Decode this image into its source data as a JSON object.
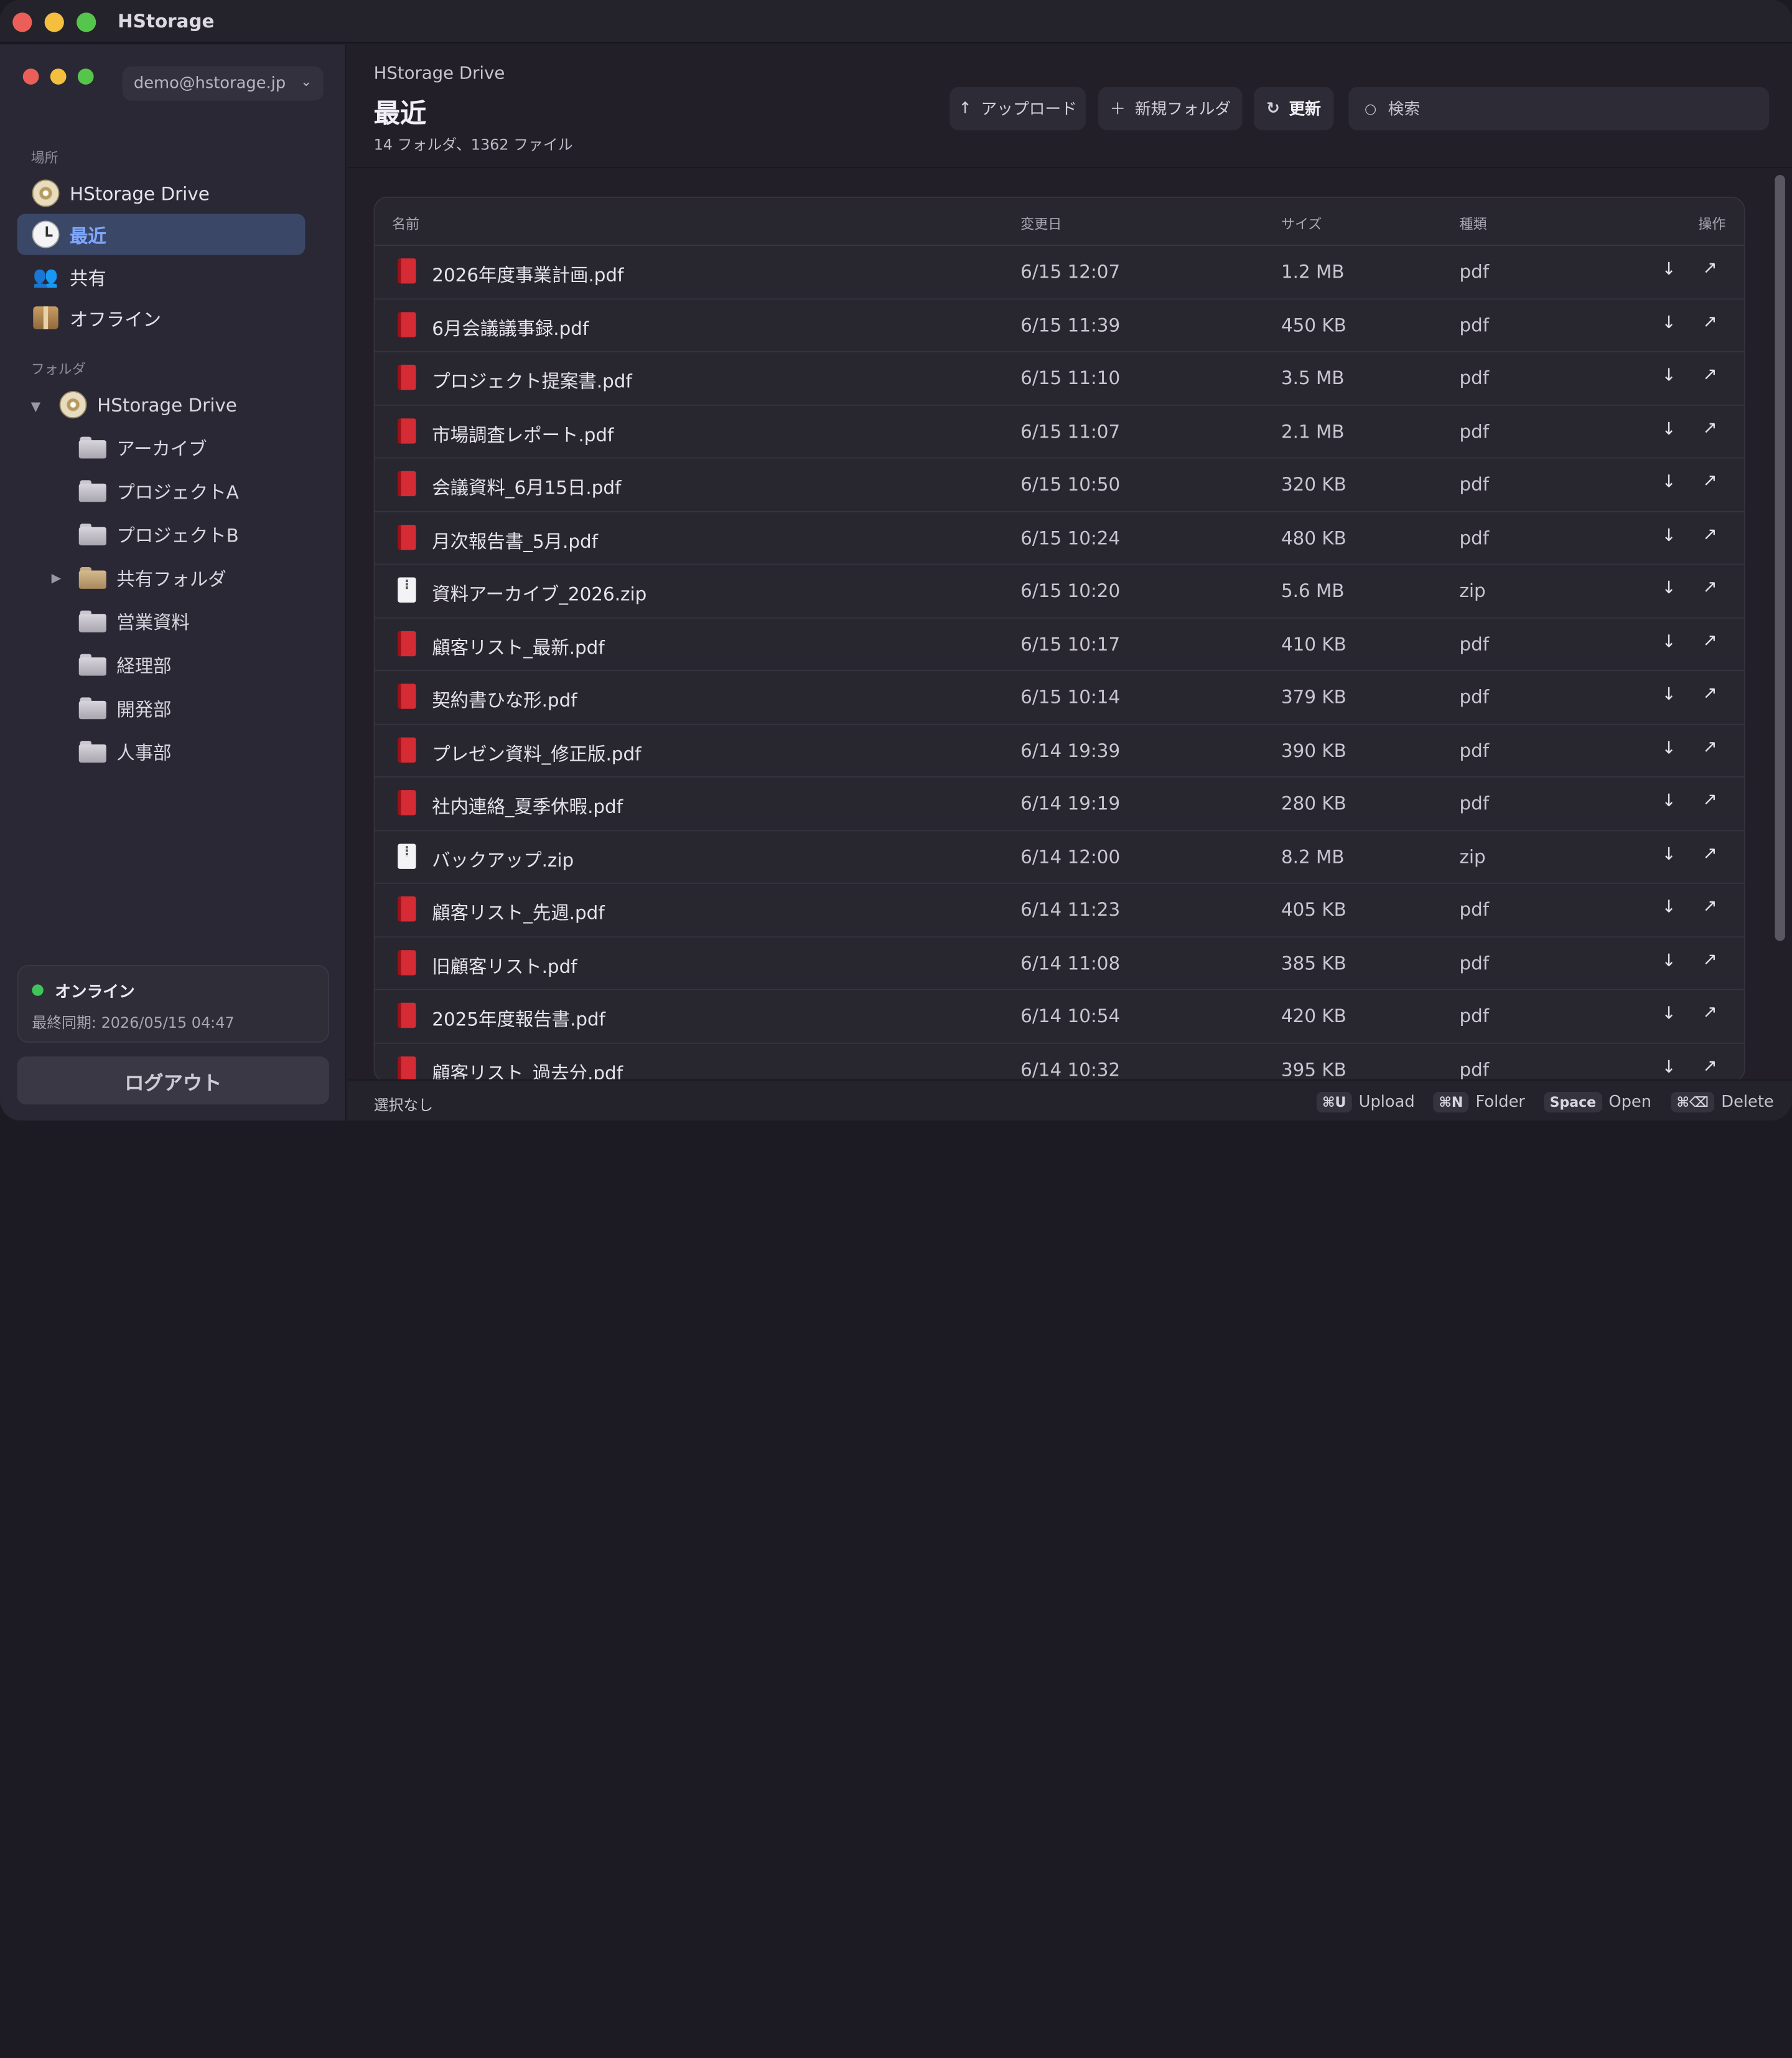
{
  "app": {
    "title": "HStorage"
  },
  "sidebar": {
    "account": "demo@hstorage.jp",
    "places_label": "場所",
    "places": [
      {
        "label": "HStorage Drive",
        "icon": "drive-disc-icon"
      },
      {
        "label": "最近",
        "icon": "clock-icon"
      },
      {
        "label": "共有",
        "icon": "people-icon"
      },
      {
        "label": "オフライン",
        "icon": "package-icon"
      }
    ],
    "folders_label": "フォルダ",
    "root": "HStorage Drive",
    "folders": [
      "アーカイブ",
      "プロジェクトA",
      "プロジェクトB",
      "共有フォルダ",
      "営業資料",
      "経理部",
      "開発部",
      "人事部"
    ],
    "status": "オンライン",
    "last_sync": "最終同期: 2026/05/15 04:47",
    "logout": "ログアウト"
  },
  "main": {
    "breadcrumb": "HStorage Drive",
    "title": "最近",
    "summary": "14 フォルダ、1362 ファイル",
    "toolbar": {
      "upload": "アップロード",
      "new_folder": "新規フォルダ",
      "refresh": "更新",
      "search_placeholder": "検索"
    },
    "columns": {
      "name": "名前",
      "modified": "変更日",
      "size": "サイズ",
      "kind": "種類",
      "actions": "操作"
    },
    "files": [
      {
        "name": "2026年度事業計画.pdf",
        "date": "6/15 12:07",
        "size": "1.2 MB",
        "kind": "pdf"
      },
      {
        "name": "6月会議議事録.pdf",
        "date": "6/15 11:39",
        "size": "450 KB",
        "kind": "pdf"
      },
      {
        "name": "プロジェクト提案書.pdf",
        "date": "6/15 11:10",
        "size": "3.5 MB",
        "kind": "pdf"
      },
      {
        "name": "市場調査レポート.pdf",
        "date": "6/15 11:07",
        "size": "2.1 MB",
        "kind": "pdf"
      },
      {
        "name": "会議資料_6月15日.pdf",
        "date": "6/15 10:50",
        "size": "320 KB",
        "kind": "pdf"
      },
      {
        "name": "月次報告書_5月.pdf",
        "date": "6/15 10:24",
        "size": "480 KB",
        "kind": "pdf"
      },
      {
        "name": "資料アーカイブ_2026.zip",
        "date": "6/15 10:20",
        "size": "5.6 MB",
        "kind": "zip"
      },
      {
        "name": "顧客リスト_最新.pdf",
        "date": "6/15 10:17",
        "size": "410 KB",
        "kind": "pdf"
      },
      {
        "name": "契約書ひな形.pdf",
        "date": "6/15 10:14",
        "size": "379 KB",
        "kind": "pdf"
      },
      {
        "name": "プレゼン資料_修正版.pdf",
        "date": "6/14 19:39",
        "size": "390 KB",
        "kind": "pdf"
      },
      {
        "name": "社内連絡_夏季休暇.pdf",
        "date": "6/14 19:19",
        "size": "280 KB",
        "kind": "pdf"
      },
      {
        "name": "バックアップ.zip",
        "date": "6/14 12:00",
        "size": "8.2 MB",
        "kind": "zip"
      },
      {
        "name": "顧客リスト_先週.pdf",
        "date": "6/14 11:23",
        "size": "405 KB",
        "kind": "pdf"
      },
      {
        "name": "旧顧客リスト.pdf",
        "date": "6/14 11:08",
        "size": "385 KB",
        "kind": "pdf"
      },
      {
        "name": "2025年度報告書.pdf",
        "date": "6/14 10:54",
        "size": "420 KB",
        "kind": "pdf"
      },
      {
        "name": "顧客リスト_過去分.pdf",
        "date": "6/14 10:32",
        "size": "395 KB",
        "kind": "pdf"
      }
    ],
    "footer": {
      "selection": "選択なし",
      "shortcuts": [
        {
          "key": "⌘U",
          "label": "Upload"
        },
        {
          "key": "⌘N",
          "label": "Folder"
        },
        {
          "key": "Space",
          "label": "Open"
        },
        {
          "key": "⌘⌫",
          "label": "Delete"
        }
      ]
    }
  },
  "colors": {
    "accent": "#7fa7ff",
    "active_bg": "#3b4767",
    "pdf": "#d42b34",
    "online": "#3ec45a"
  }
}
